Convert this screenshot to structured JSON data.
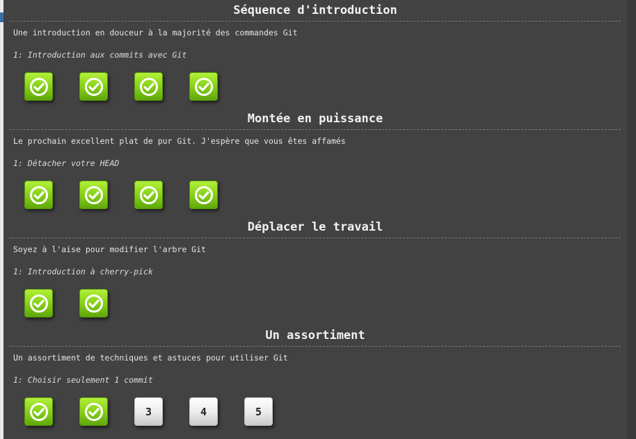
{
  "sections": [
    {
      "title": "Séquence d'introduction",
      "description": "Une introduction en douceur à la majorité des commandes Git",
      "sublevel": "1: Introduction aux commits avec Git",
      "levels": [
        {
          "status": "done",
          "label": ""
        },
        {
          "status": "done",
          "label": ""
        },
        {
          "status": "done",
          "label": ""
        },
        {
          "status": "done",
          "label": ""
        }
      ]
    },
    {
      "title": "Montée en puissance",
      "description": "Le prochain excellent plat de pur Git. J'espère que vous êtes affamés",
      "sublevel": "1: Détacher votre HEAD",
      "levels": [
        {
          "status": "done",
          "label": ""
        },
        {
          "status": "done",
          "label": ""
        },
        {
          "status": "done",
          "label": ""
        },
        {
          "status": "done",
          "label": ""
        }
      ]
    },
    {
      "title": "Déplacer le travail",
      "description": "Soyez à l'aise pour modifier l'arbre Git",
      "sublevel": "1: Introduction à cherry-pick",
      "levels": [
        {
          "status": "done",
          "label": ""
        },
        {
          "status": "done",
          "label": ""
        }
      ]
    },
    {
      "title": "Un assortiment",
      "description": "Un assortiment de techniques et astuces pour utiliser Git",
      "sublevel": "1: Choisir seulement 1 commit",
      "levels": [
        {
          "status": "done",
          "label": ""
        },
        {
          "status": "done",
          "label": ""
        },
        {
          "status": "todo",
          "label": "3"
        },
        {
          "status": "todo",
          "label": "4"
        },
        {
          "status": "todo",
          "label": "5"
        }
      ]
    }
  ],
  "icons": {
    "completed": "checkmark-circle-icon"
  },
  "colors": {
    "panel_background": "#424242",
    "completed_green": "#8cd41c",
    "pending_gray": "#eaeaea"
  }
}
